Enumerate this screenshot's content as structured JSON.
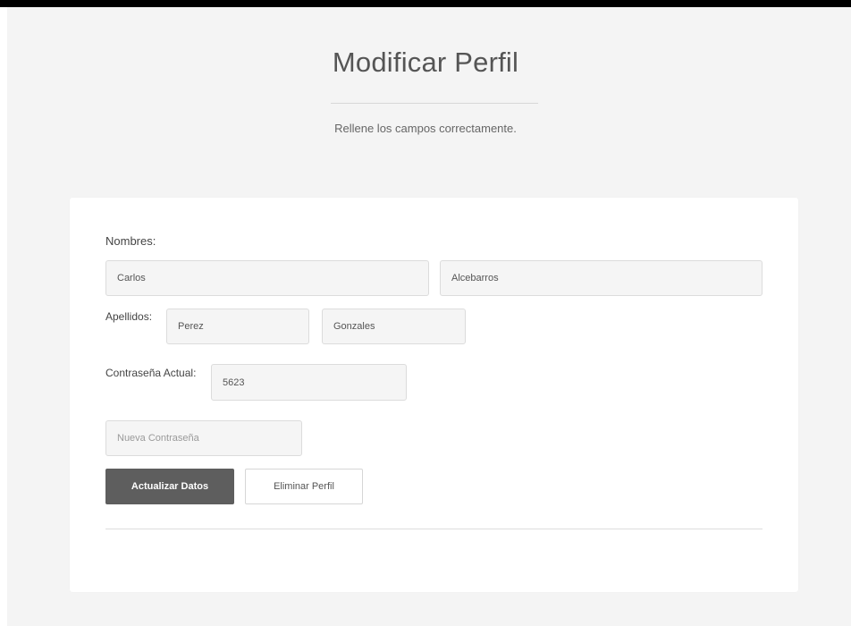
{
  "header": {
    "title": "Modificar Perfil",
    "subtitle": "Rellene los campos correctamente."
  },
  "form": {
    "nombres_label": "Nombres:",
    "nombre1": {
      "value": "Carlos",
      "placeholder": ""
    },
    "nombre2": {
      "value": "Alcebarros",
      "placeholder": ""
    },
    "apellidos_label": "Apellidos:",
    "apellido1": {
      "value": "Perez",
      "placeholder": ""
    },
    "apellido2": {
      "value": "Gonzales",
      "placeholder": ""
    },
    "current_password_label": "Contraseña Actual:",
    "current_password": {
      "value": "5623",
      "placeholder": ""
    },
    "new_password": {
      "value": "",
      "placeholder": "Nueva Contraseña"
    }
  },
  "actions": {
    "update_label": "Actualizar Datos",
    "delete_label": "Eliminar Perfil"
  },
  "colors": {
    "page_background": "#f4f4f4",
    "card_background": "#ffffff",
    "primary_button": "#5e5e5e",
    "top_strip": "#000000"
  }
}
